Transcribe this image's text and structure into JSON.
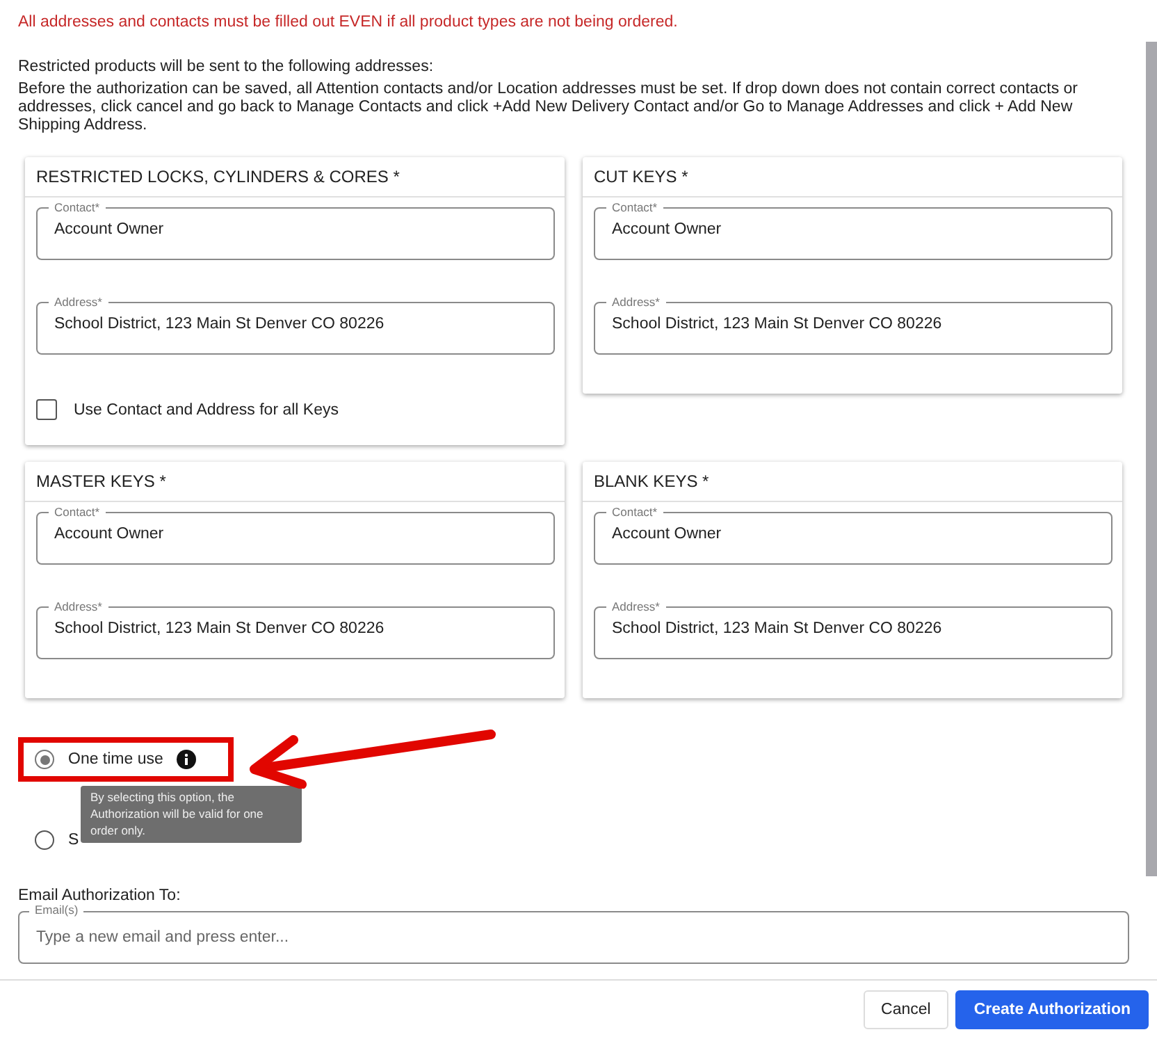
{
  "notice": "All addresses and contacts must be filled out EVEN if all product types are not being ordered.",
  "intro_heading": "Restricted products will be sent to the following addresses:",
  "intro_text": "Before the authorization can be saved, all Attention contacts and/or Location addresses must be set. If drop down does not contain correct contacts or addresses, click cancel and go back to Manage Contacts and click +Add New Delivery Contact and/or Go to Manage Addresses and click + Add New Shipping Address.",
  "cards": [
    {
      "title": "RESTRICTED LOCKS, CYLINDERS & CORES *",
      "contact": {
        "label": "Contact*",
        "value": "Account Owner"
      },
      "address": {
        "label": "Address*",
        "value": "School District, 123 Main St Denver  CO 80226"
      },
      "checkbox": {
        "label": "Use Contact and Address for all Keys",
        "checked": false
      }
    },
    {
      "title": "CUT KEYS *",
      "contact": {
        "label": "Contact*",
        "value": "Account Owner"
      },
      "address": {
        "label": "Address*",
        "value": "School District, 123 Main St Denver  CO 80226"
      }
    },
    {
      "title": "MASTER KEYS *",
      "contact": {
        "label": "Contact*",
        "value": "Account Owner"
      },
      "address": {
        "label": "Address*",
        "value": "School District, 123 Main St Denver  CO 80226"
      }
    },
    {
      "title": "BLANK KEYS *",
      "contact": {
        "label": "Contact*",
        "value": "Account Owner"
      },
      "address": {
        "label": "Address*",
        "value": "School District, 123 Main St Denver  CO 80226"
      }
    }
  ],
  "usage_options": [
    {
      "label": "One time use",
      "selected": true,
      "highlighted": true
    },
    {
      "label": "S",
      "selected": false,
      "highlighted": false
    }
  ],
  "tooltip": "By selecting this option, the Authorization will be valid for one order only.",
  "email": {
    "heading": "Email Authorization To:",
    "label": "Email(s)",
    "placeholder": "Type a new email and press enter..."
  },
  "buttons": [
    {
      "label": "Cancel",
      "kind": "secondary"
    },
    {
      "label": "Create Authorization",
      "kind": "primary"
    }
  ]
}
